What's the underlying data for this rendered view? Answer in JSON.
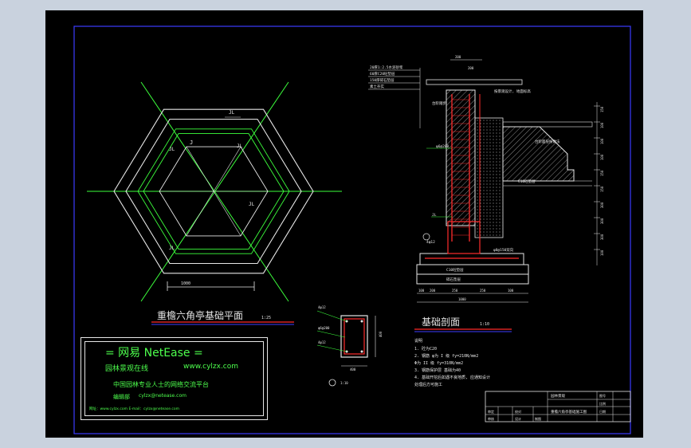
{
  "plan": {
    "title": "重檐六角亭基础平面",
    "scale": "1:25",
    "jl_label": "JL",
    "j_label": "J",
    "dimension": "1000"
  },
  "section": {
    "title": "基础剖面",
    "scale": "1:10",
    "layer_labels": [
      "20厚1:2.5水泥砂浆",
      "60厚C20砼垫层",
      "150厚碎石垫层",
      "素土夯实"
    ],
    "top_note": "按景观设计, 地面标高",
    "side_label": "台阶踏步",
    "step_label": "台阶面层按做法",
    "c10_label": "C10砼垫层",
    "c10_bottom": "C10砼垫层",
    "gravel": "碎石垫层",
    "bottom_dims": [
      "100",
      "200",
      "250",
      "250",
      "100"
    ],
    "total_dim": "1000",
    "top_dims": [
      "200",
      "200"
    ],
    "right_dims": [
      "150",
      "100",
      "100",
      "100",
      "150",
      "150",
      "300",
      "300",
      "300",
      "100"
    ],
    "rebar_labels": [
      "φ6@200",
      "φ8@200",
      "JL",
      "4φ12",
      "φ8@150双向"
    ]
  },
  "detail": {
    "scale": "1:10",
    "labels": [
      "4φ12",
      "φ6@200",
      "4φ12"
    ],
    "width": "400",
    "height": "400"
  },
  "notes": {
    "heading": "说明",
    "items": [
      "1.  砼为C20",
      "2.  钢筋 φ为 I 级  fy=210N/mm2",
      "     Φ为 II 级  fy=310N/mm2",
      "3.  钢筋保护层  基础为40",
      "4.  基础开挖后如遇不良地质, 应通知设计",
      "     处理后方可施工"
    ]
  },
  "stamp": {
    "brand": "= 网易 NetEase =",
    "subtitle": "园林景观在线",
    "url": "www.cylzx.com",
    "tagline": "中国园林专业人士的网络交流平台",
    "email_label": "编辑部",
    "email": "cylzx@netease.com",
    "footer": "网址：www.cylzx.com  E-mail：cylzx@netease.com"
  },
  "titleblock": {
    "project": "园林景观",
    "drawing": "重檐六角亭基础施工图",
    "cells": [
      "审定",
      "审核",
      "校对",
      "设计",
      "制图",
      "图号",
      "比例",
      "日期"
    ]
  }
}
